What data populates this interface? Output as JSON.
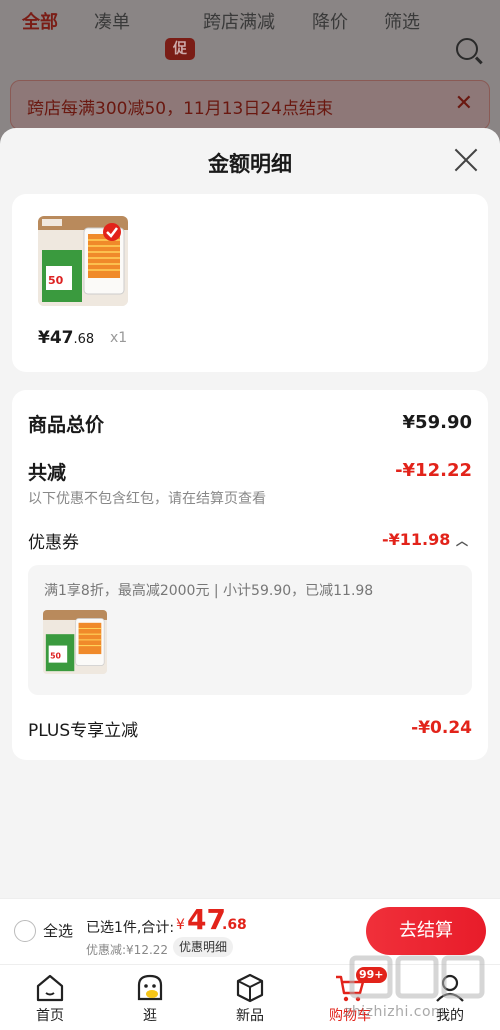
{
  "background": {
    "tabs": [
      "全部",
      "凑单",
      "跨店满减",
      "降价",
      "筛选"
    ],
    "promo_badge": "促",
    "banner_text": "跨店每满300减50，11月13日24点结束"
  },
  "sheet": {
    "title": "金额明细",
    "product": {
      "price_main": "¥47",
      "price_decimal": ".68",
      "quantity": "x1"
    },
    "summary": {
      "goods_total_label": "商品总价",
      "goods_total_value": "¥59.90",
      "total_discount_label": "共减",
      "total_discount_value": "-¥12.22",
      "note": "以下优惠不包含红包，请在结算页查看",
      "coupon_label": "优惠券",
      "coupon_value": "-¥11.98",
      "coupon_rule": "满1享8折，最高减2000元 | 小计59.90，已减11.98",
      "plus_label": "PLUS专享立减",
      "plus_value": "-¥0.24"
    }
  },
  "checkout": {
    "select_all": "全选",
    "selected_info": "已选1件,合计:",
    "currency": "¥",
    "total_main": "47",
    "total_decimal": ".68",
    "discount_line": "优惠减:¥12.22",
    "detail_pill": "优惠明细",
    "button": "去结算"
  },
  "tabbar": {
    "items": [
      "首页",
      "逛",
      "新品",
      "购物车",
      "我的"
    ],
    "cart_badge": "99+"
  },
  "watermark": "zhizhizhi.com",
  "colors": {
    "accent": "#e2231a",
    "sheet_bg": "#f4f4f4"
  }
}
